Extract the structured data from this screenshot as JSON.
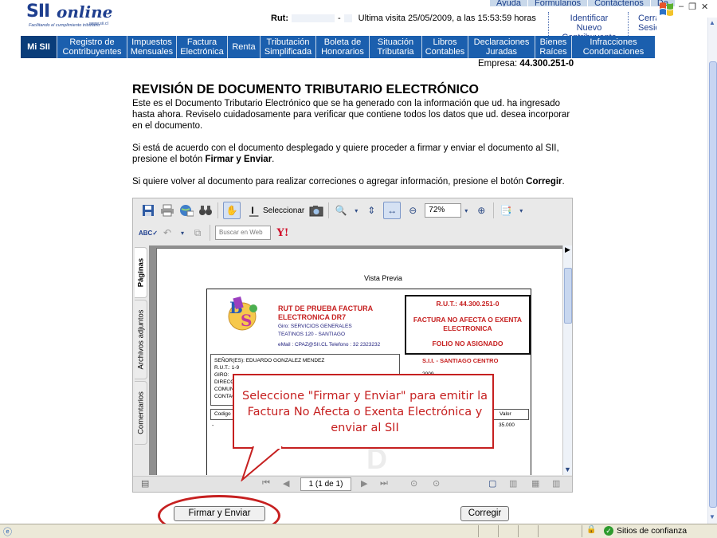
{
  "colors": {
    "menu_bg": "#1b5fae",
    "menu_active": "#0a3d7a",
    "accent_red": "#c62020",
    "logo_blue": "#1f3f8f"
  },
  "toplinks": [
    "Ayuda",
    "Formularios",
    "Contáctenos",
    "De"
  ],
  "logo": {
    "brand_a": "SII",
    "brand_b": "online",
    "tagline": "Facilitando el cumplimiento tributario",
    "url": "www.sii.cl"
  },
  "header": {
    "rut_label": "Rut:",
    "rut_separator": "-",
    "last_visit": "Ultima visita 25/05/2009, a las 15:53:59 horas",
    "links": [
      "Identificar Nuevo Contribuyente",
      "Cerrar Sesión"
    ]
  },
  "menu": [
    {
      "label": "Mi SII"
    },
    {
      "label": "Registro de Contribuyentes"
    },
    {
      "label": "Impuestos Mensuales"
    },
    {
      "label": "Factura Electrónica"
    },
    {
      "label": "Renta"
    },
    {
      "label": "Tributación Simplificada"
    },
    {
      "label": "Boleta de Honorarios"
    },
    {
      "label": "Situación Tributaria"
    },
    {
      "label": "Libros Contables"
    },
    {
      "label": "Declaraciones Juradas"
    },
    {
      "label": "Bienes Raíces"
    },
    {
      "label": "Infracciones Condonaciones"
    }
  ],
  "empresa": {
    "label": "Empresa:",
    "value": "44.300.251-0"
  },
  "content": {
    "title": "REVISIÓN DE DOCUMENTO TRIBUTARIO ELECTRÓNICO",
    "para1": "Este es el Documento Tributario Electrónico que se ha generado con la información que ud. ha ingresado hasta ahora. Reviselo cuidadosamente para verificar que contiene todos los datos que ud. desea incorporar en el documento.",
    "para2_a": "Si está de acuerdo con el documento desplegado y quiere proceder a firmar y enviar el documento al SII, presione el botón ",
    "para2_b": "Firmar y Enviar",
    "para2_c": ".",
    "para3_a": "Si quiere volver al documento para realizar correciones o agregar información, presione el botón ",
    "para3_b": "Corregir",
    "para3_c": "."
  },
  "viewer": {
    "select_label": "Seleccionar",
    "zoom": "72%",
    "search_placeholder": "Buscar en Web",
    "side_tabs": [
      "Páginas",
      "Archivos adjuntos",
      "Comentarios"
    ],
    "page_indicator": "1 (1 de 1)",
    "preview_title": "Vista Previa",
    "invoice": {
      "company": "RUT DE PRUEBA FACTURA ELECTRONICA DR7",
      "giro": "Giro: SERVICIOS GENERALES",
      "address": "TEATINOS 120 - SANTIAGO",
      "email": "eMail : CPAZ@SII.CL Telefono : 32 2323232",
      "rut_box": "R.U.T.: 44.300.251-0",
      "doc_type": "FACTURA NO AFECTA O EXENTA ELECTRONICA",
      "folio": "FOLIO NO ASIGNADO",
      "sii_office": "S.I.I. - SANTIAGO CENTRO",
      "fecha": "2009",
      "receiver": [
        "SEÑOR(ES): EDUARDO GONZALEZ MENDEZ",
        "R.U.T.:      1-9",
        "GIRO:",
        "DIRECC",
        "COMUN",
        "CONTAC"
      ],
      "col_codigo": "Codigo",
      "col_valor": "Valor",
      "row_first": "-",
      "row_value": "35.000"
    }
  },
  "callout": {
    "text": "Seleccione \"Firmar y Enviar\" para emitir la Factura No Afecta o Exenta Electrónica y enviar al SII"
  },
  "buttons": {
    "firmar": "Firmar y Enviar",
    "corregir": "Corregir"
  },
  "status_bar": {
    "trusted": "Sitios de confianza"
  }
}
